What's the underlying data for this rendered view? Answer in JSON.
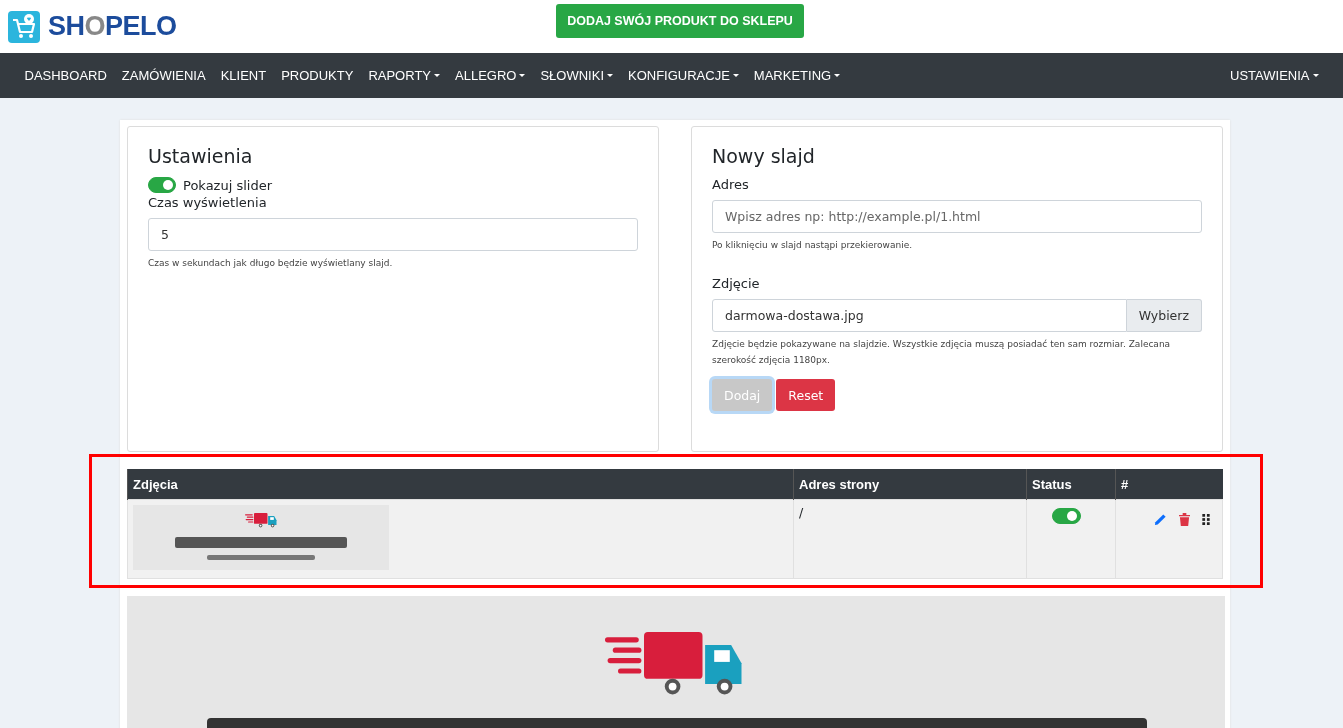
{
  "header": {
    "logo": "SHOPELO",
    "cta_button": "DODAJ SWÓJ PRODUKT DO SKLEPU"
  },
  "nav": {
    "items": [
      {
        "label": "DASHBOARD",
        "dropdown": false
      },
      {
        "label": "ZAMÓWIENIA",
        "dropdown": false
      },
      {
        "label": "KLIENT",
        "dropdown": false
      },
      {
        "label": "PRODUKTY",
        "dropdown": false
      },
      {
        "label": "RAPORTY",
        "dropdown": true
      },
      {
        "label": "ALLEGRO",
        "dropdown": true
      },
      {
        "label": "SŁOWNIKI",
        "dropdown": true
      },
      {
        "label": "KONFIGURACJE",
        "dropdown": true
      },
      {
        "label": "MARKETING",
        "dropdown": true
      }
    ],
    "right_item": {
      "label": "USTAWIENIA",
      "dropdown": true
    }
  },
  "settings_card": {
    "title": "Ustawienia",
    "toggle": {
      "label": "Pokazuj slider",
      "on": true
    },
    "field_label": "Czas wyświetlenia",
    "field_value": "5",
    "help": "Czas w sekundach jak długo będzie wyświetlany slajd."
  },
  "new_slide_card": {
    "title": "Nowy slajd",
    "address_label": "Adres",
    "address_placeholder": "Wpisz adres np: http://example.pl/1.html",
    "address_help": "Po kliknięciu w slajd nastąpi przekierowanie.",
    "image_label": "Zdjęcie",
    "image_value": "darmowa-dostawa.jpg",
    "browse_button": "Wybierz",
    "image_help": "Zdjęcie będzie pokazywane na slajdzie. Wszystkie zdjęcia muszą posiadać ten sam rozmiar. Zalecana szerokość zdjęcia 1180px.",
    "buttons": [
      {
        "label": "Dodaj",
        "disabled": true
      },
      {
        "label": "Reset",
        "disabled": false
      }
    ]
  },
  "table": {
    "highlighted": true,
    "columns": [
      "Zdjęcia",
      "Adres strony",
      "Status",
      "#"
    ],
    "rows": [
      {
        "address": "/",
        "status_on": true
      }
    ]
  }
}
